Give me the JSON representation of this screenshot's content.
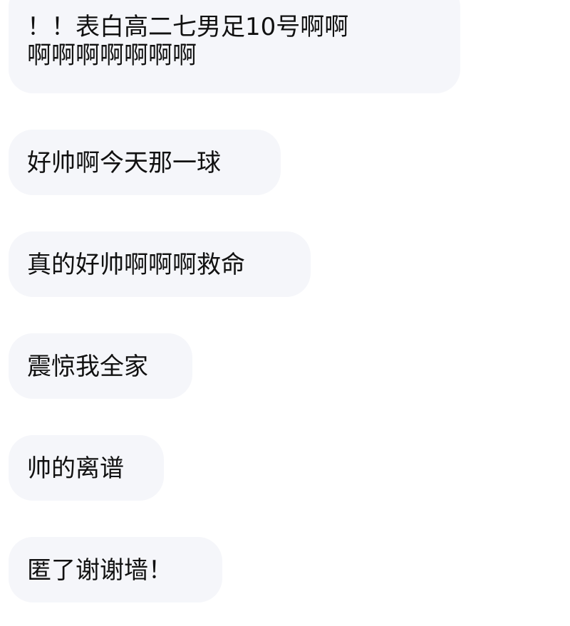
{
  "messages": [
    {
      "lines": [
        "！！表白高二七男足10号啊啊",
        "啊啊啊啊啊啊啊"
      ]
    },
    {
      "lines": [
        "好帅啊今天那一球"
      ]
    },
    {
      "lines": [
        "真的好帅啊啊啊救命"
      ]
    },
    {
      "lines": [
        "震惊我全家"
      ]
    },
    {
      "lines": [
        "帅的离谱"
      ]
    },
    {
      "lines": [
        "匿了谢谢墙！"
      ]
    }
  ],
  "colors": {
    "background": "#ffffff",
    "bubble": "#f5f6fa",
    "text": "#111111"
  }
}
